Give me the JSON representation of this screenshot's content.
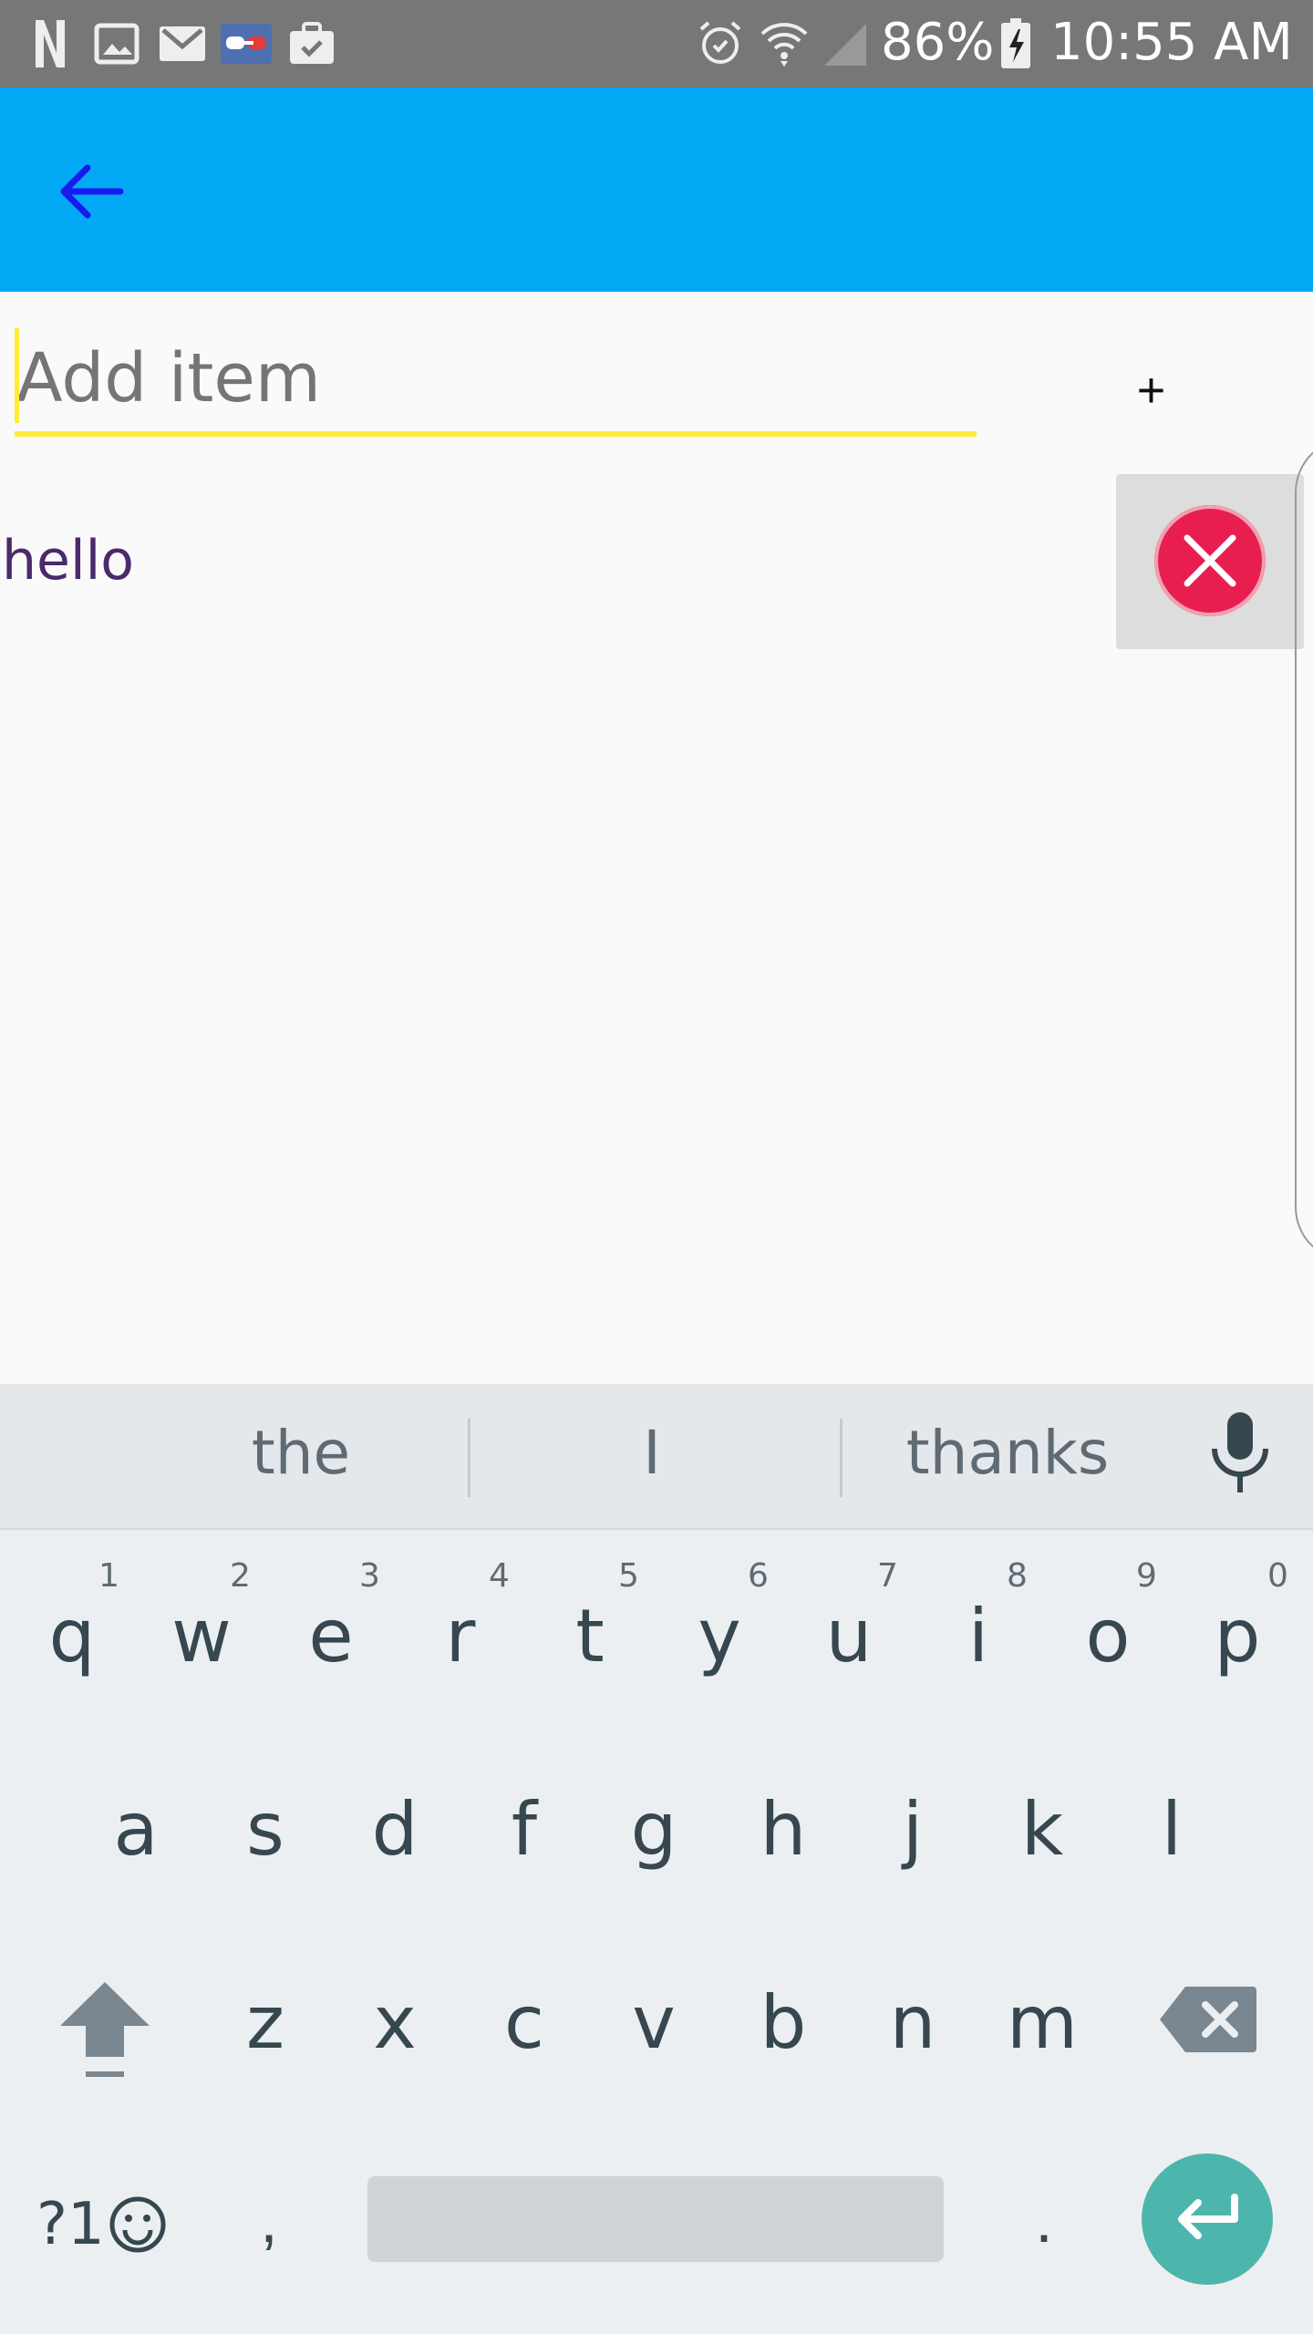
{
  "status_bar": {
    "battery": "86%",
    "time": "10:55 AM",
    "icons": [
      "netflix-icon",
      "gallery-icon",
      "gmail-icon",
      "goggles-icon",
      "briefcase-icon",
      "alarm-icon",
      "wifi-icon",
      "signal-icon",
      "battery-charging-icon"
    ]
  },
  "app_bar": {
    "back_icon": "arrow-left-icon",
    "color": "#03a9f4"
  },
  "add_item": {
    "placeholder": "Add item",
    "value": "",
    "add_label": "+"
  },
  "list": {
    "items": [
      {
        "label": "hello",
        "delete_icon": "close-circle-icon"
      }
    ]
  },
  "keyboard": {
    "suggestions": [
      "the",
      "I",
      "thanks"
    ],
    "row1": [
      "q",
      "w",
      "e",
      "r",
      "t",
      "y",
      "u",
      "i",
      "o",
      "p"
    ],
    "row1_hints": [
      "1",
      "2",
      "3",
      "4",
      "5",
      "6",
      "7",
      "8",
      "9",
      "0"
    ],
    "row2": [
      "a",
      "s",
      "d",
      "f",
      "g",
      "h",
      "j",
      "k",
      "l"
    ],
    "row3": [
      "z",
      "x",
      "c",
      "v",
      "b",
      "n",
      "m"
    ],
    "symbols_label": "?1",
    "comma": ",",
    "period": ".",
    "enter_color": "#4db6ac"
  }
}
